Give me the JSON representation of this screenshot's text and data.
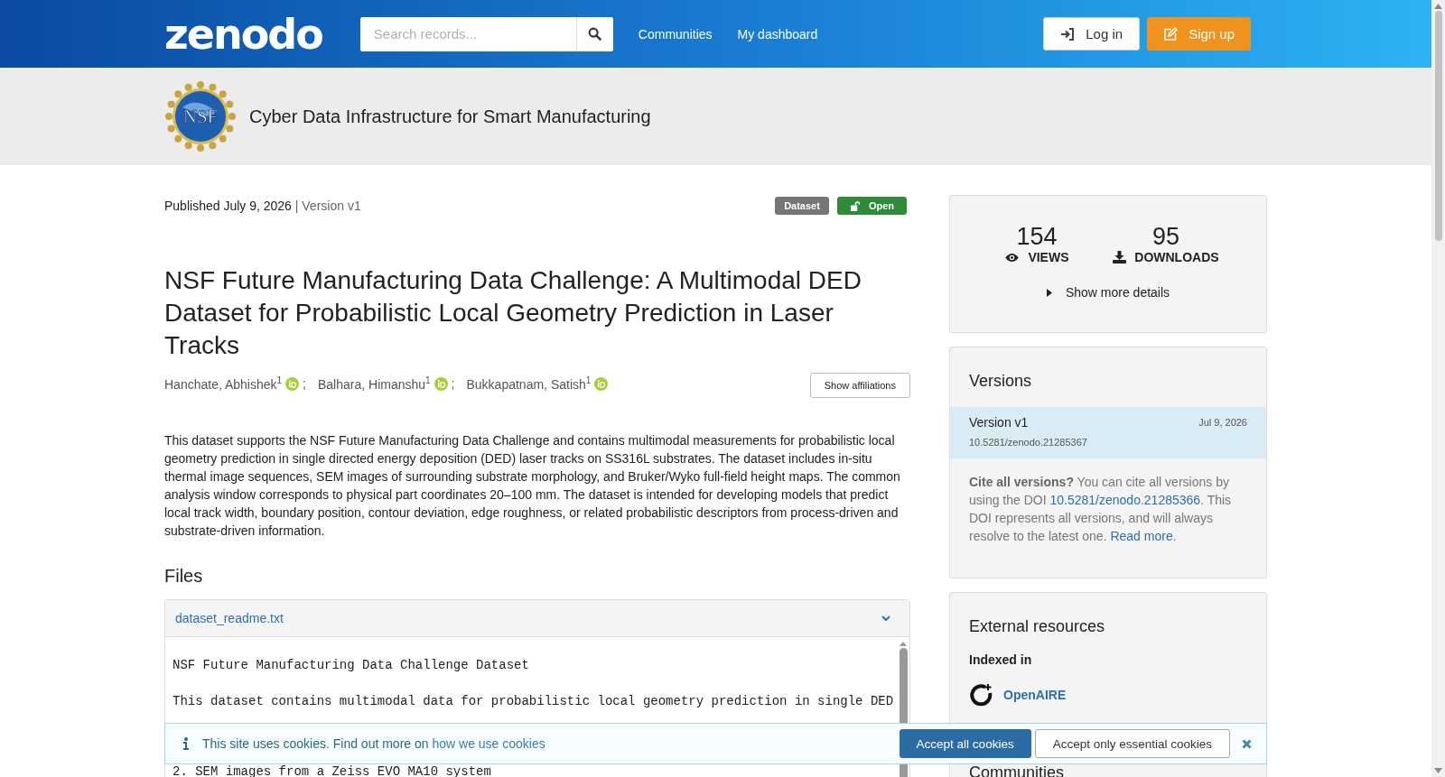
{
  "header": {
    "logo_text": "zenodo",
    "search": {
      "placeholder": "Search records..."
    },
    "nav": [
      {
        "label": "Communities"
      },
      {
        "label": "My dashboard"
      }
    ],
    "buttons": [
      {
        "label": "Log in",
        "kind": "login"
      },
      {
        "label": "Sign up",
        "kind": "signup"
      }
    ]
  },
  "community": {
    "logo_text": "NSF",
    "name": "Cyber Data Infrastructure for Smart Manufacturing"
  },
  "record": {
    "published": "Published July 9, 2026",
    "separator": "|",
    "version": "Version v1",
    "badges": [
      {
        "label": "Dataset",
        "kind": "type"
      },
      {
        "label": "Open",
        "kind": "access"
      }
    ],
    "title": "NSF Future Manufacturing Data Challenge: A Multimodal DED Dataset for Probabilistic Local Geometry Prediction in Laser Tracks",
    "creators": [
      {
        "name": "Hanchate, Abhishek$^{1}$",
        "separator": ";"
      },
      {
        "name": "Balhara, Himanshu$^{1}$",
        "separator": ";"
      },
      {
        "name": "Bukkapatnam, Satish$^{1}$"
      }
    ],
    "affiliations_button": "Show affiliations",
    "description": "This dataset supports the NSF Future Manufacturing Data Challenge and contains multimodal measurements for probabilistic local geometry prediction in single directed energy deposition (DED) laser tracks on SS316L substrates. The dataset includes in-situ thermal image sequences, SEM images of surrounding substrate morphology, and Bruker/Wyko full-field height maps. The common analysis window corresponds to physical part coordinates 20–100 mm. The dataset is intended for developing models that predict local track width, boundary position, contour deviation, edge roughness, or related probabilistic descriptors from process-driven and substrate-driven information.",
    "files_heading": "Files",
    "file": {
      "name": "dataset_readme.txt",
      "expanded": true,
      "lines": [
        "NSF Future Manufacturing Data Challenge Dataset",
        "This dataset contains multimodal data for probabilistic local geometry prediction in single DED",
        "2. SEM images from a Zeiss EVO MA10 system"
      ]
    }
  },
  "sidebar": {
    "stats": [
      {
        "value": "154",
        "label": "VIEWS",
        "kind": "views"
      },
      {
        "value": "95",
        "label": "DOWNLOADS",
        "kind": "downloads"
      }
    ],
    "more_details": "Show more details",
    "versions": {
      "heading": "Versions",
      "items": [
        {
          "label": "Version v1",
          "date": "Jul 9, 2026",
          "doi": "10.5281/zenodo.21285367",
          "selected": true
        }
      ],
      "cite": {
        "bold": "Cite all versions?",
        "text": " You can cite all versions by using the DOI ",
        "doi": "10.5281/zenodo.21285366",
        "text2": ". This DOI represents all versions, and will always resolve to the latest one. ",
        "link": "Read more",
        "end": "."
      }
    },
    "external": {
      "heading": "External resources",
      "indexed_label": "Indexed in",
      "items": [
        {
          "name": "OpenAIRE"
        }
      ]
    },
    "communities_heading": "Communities"
  },
  "cookie_banner": {
    "text": "This site uses cookies. Find out more on ",
    "link": "how we use cookies",
    "buttons": [
      {
        "label": "Accept all cookies",
        "kind": "primary"
      },
      {
        "label": "Accept only essential cookies",
        "kind": "secondary"
      }
    ]
  }
}
